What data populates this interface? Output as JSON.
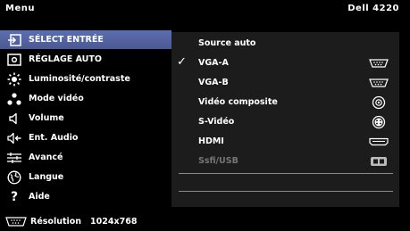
{
  "header": {
    "title": "Menu",
    "model": "Dell 4220"
  },
  "menu": {
    "items": [
      {
        "label": "SÉLECT ENTRÉE",
        "icon": "input-select-icon",
        "active": true
      },
      {
        "label": "RÉGLAGE AUTO",
        "icon": "auto-adjust-icon"
      },
      {
        "label": "Luminosité/contraste",
        "icon": "brightness-icon"
      },
      {
        "label": "Mode vidéo",
        "icon": "video-mode-icon"
      },
      {
        "label": "Volume",
        "icon": "volume-icon"
      },
      {
        "label": "Ent. Audio",
        "icon": "audio-input-icon"
      },
      {
        "label": "Avancé",
        "icon": "advanced-settings-icon"
      },
      {
        "label": "Langue",
        "icon": "language-icon"
      },
      {
        "label": "Aide",
        "icon": "help-icon"
      }
    ]
  },
  "submenu": {
    "items": [
      {
        "label": "Source auto",
        "icon": ""
      },
      {
        "label": "VGA-A",
        "icon": "vga-port-icon",
        "checked": true
      },
      {
        "label": "VGA-B",
        "icon": "vga-port-icon"
      },
      {
        "label": "Vidéo composite",
        "icon": "composite-port-icon"
      },
      {
        "label": "S-Vidéo",
        "icon": "s-video-port-icon"
      },
      {
        "label": "HDMI",
        "icon": "hdmi-port-icon"
      },
      {
        "label": "Ssfi/USB",
        "icon": "usb-display-icon",
        "disabled": true
      }
    ],
    "checkmark": "✓"
  },
  "footer": {
    "resolution_label": "Résolution",
    "resolution_value": "1024x768"
  },
  "colors": {
    "active_bg": "#5b6fae",
    "panel_bg": "#1c1c1c",
    "disabled_text": "#767676"
  }
}
